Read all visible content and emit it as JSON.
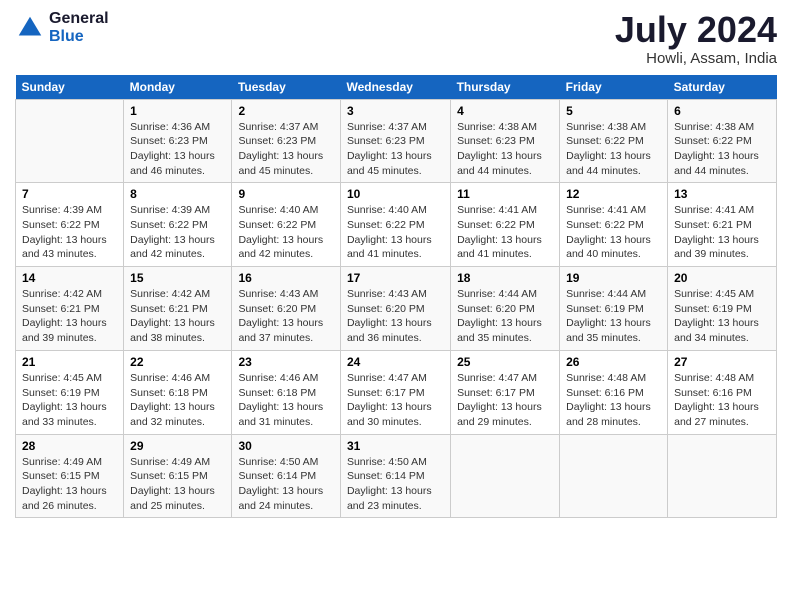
{
  "header": {
    "logo_general": "General",
    "logo_blue": "Blue",
    "month": "July 2024",
    "location": "Howli, Assam, India"
  },
  "days_of_week": [
    "Sunday",
    "Monday",
    "Tuesday",
    "Wednesday",
    "Thursday",
    "Friday",
    "Saturday"
  ],
  "weeks": [
    [
      {
        "day": "",
        "sunrise": "",
        "sunset": "",
        "daylight": ""
      },
      {
        "day": "1",
        "sunrise": "Sunrise: 4:36 AM",
        "sunset": "Sunset: 6:23 PM",
        "daylight": "Daylight: 13 hours and 46 minutes."
      },
      {
        "day": "2",
        "sunrise": "Sunrise: 4:37 AM",
        "sunset": "Sunset: 6:23 PM",
        "daylight": "Daylight: 13 hours and 45 minutes."
      },
      {
        "day": "3",
        "sunrise": "Sunrise: 4:37 AM",
        "sunset": "Sunset: 6:23 PM",
        "daylight": "Daylight: 13 hours and 45 minutes."
      },
      {
        "day": "4",
        "sunrise": "Sunrise: 4:38 AM",
        "sunset": "Sunset: 6:23 PM",
        "daylight": "Daylight: 13 hours and 44 minutes."
      },
      {
        "day": "5",
        "sunrise": "Sunrise: 4:38 AM",
        "sunset": "Sunset: 6:22 PM",
        "daylight": "Daylight: 13 hours and 44 minutes."
      },
      {
        "day": "6",
        "sunrise": "Sunrise: 4:38 AM",
        "sunset": "Sunset: 6:22 PM",
        "daylight": "Daylight: 13 hours and 44 minutes."
      }
    ],
    [
      {
        "day": "7",
        "sunrise": "Sunrise: 4:39 AM",
        "sunset": "Sunset: 6:22 PM",
        "daylight": "Daylight: 13 hours and 43 minutes."
      },
      {
        "day": "8",
        "sunrise": "Sunrise: 4:39 AM",
        "sunset": "Sunset: 6:22 PM",
        "daylight": "Daylight: 13 hours and 42 minutes."
      },
      {
        "day": "9",
        "sunrise": "Sunrise: 4:40 AM",
        "sunset": "Sunset: 6:22 PM",
        "daylight": "Daylight: 13 hours and 42 minutes."
      },
      {
        "day": "10",
        "sunrise": "Sunrise: 4:40 AM",
        "sunset": "Sunset: 6:22 PM",
        "daylight": "Daylight: 13 hours and 41 minutes."
      },
      {
        "day": "11",
        "sunrise": "Sunrise: 4:41 AM",
        "sunset": "Sunset: 6:22 PM",
        "daylight": "Daylight: 13 hours and 41 minutes."
      },
      {
        "day": "12",
        "sunrise": "Sunrise: 4:41 AM",
        "sunset": "Sunset: 6:22 PM",
        "daylight": "Daylight: 13 hours and 40 minutes."
      },
      {
        "day": "13",
        "sunrise": "Sunrise: 4:41 AM",
        "sunset": "Sunset: 6:21 PM",
        "daylight": "Daylight: 13 hours and 39 minutes."
      }
    ],
    [
      {
        "day": "14",
        "sunrise": "Sunrise: 4:42 AM",
        "sunset": "Sunset: 6:21 PM",
        "daylight": "Daylight: 13 hours and 39 minutes."
      },
      {
        "day": "15",
        "sunrise": "Sunrise: 4:42 AM",
        "sunset": "Sunset: 6:21 PM",
        "daylight": "Daylight: 13 hours and 38 minutes."
      },
      {
        "day": "16",
        "sunrise": "Sunrise: 4:43 AM",
        "sunset": "Sunset: 6:20 PM",
        "daylight": "Daylight: 13 hours and 37 minutes."
      },
      {
        "day": "17",
        "sunrise": "Sunrise: 4:43 AM",
        "sunset": "Sunset: 6:20 PM",
        "daylight": "Daylight: 13 hours and 36 minutes."
      },
      {
        "day": "18",
        "sunrise": "Sunrise: 4:44 AM",
        "sunset": "Sunset: 6:20 PM",
        "daylight": "Daylight: 13 hours and 35 minutes."
      },
      {
        "day": "19",
        "sunrise": "Sunrise: 4:44 AM",
        "sunset": "Sunset: 6:19 PM",
        "daylight": "Daylight: 13 hours and 35 minutes."
      },
      {
        "day": "20",
        "sunrise": "Sunrise: 4:45 AM",
        "sunset": "Sunset: 6:19 PM",
        "daylight": "Daylight: 13 hours and 34 minutes."
      }
    ],
    [
      {
        "day": "21",
        "sunrise": "Sunrise: 4:45 AM",
        "sunset": "Sunset: 6:19 PM",
        "daylight": "Daylight: 13 hours and 33 minutes."
      },
      {
        "day": "22",
        "sunrise": "Sunrise: 4:46 AM",
        "sunset": "Sunset: 6:18 PM",
        "daylight": "Daylight: 13 hours and 32 minutes."
      },
      {
        "day": "23",
        "sunrise": "Sunrise: 4:46 AM",
        "sunset": "Sunset: 6:18 PM",
        "daylight": "Daylight: 13 hours and 31 minutes."
      },
      {
        "day": "24",
        "sunrise": "Sunrise: 4:47 AM",
        "sunset": "Sunset: 6:17 PM",
        "daylight": "Daylight: 13 hours and 30 minutes."
      },
      {
        "day": "25",
        "sunrise": "Sunrise: 4:47 AM",
        "sunset": "Sunset: 6:17 PM",
        "daylight": "Daylight: 13 hours and 29 minutes."
      },
      {
        "day": "26",
        "sunrise": "Sunrise: 4:48 AM",
        "sunset": "Sunset: 6:16 PM",
        "daylight": "Daylight: 13 hours and 28 minutes."
      },
      {
        "day": "27",
        "sunrise": "Sunrise: 4:48 AM",
        "sunset": "Sunset: 6:16 PM",
        "daylight": "Daylight: 13 hours and 27 minutes."
      }
    ],
    [
      {
        "day": "28",
        "sunrise": "Sunrise: 4:49 AM",
        "sunset": "Sunset: 6:15 PM",
        "daylight": "Daylight: 13 hours and 26 minutes."
      },
      {
        "day": "29",
        "sunrise": "Sunrise: 4:49 AM",
        "sunset": "Sunset: 6:15 PM",
        "daylight": "Daylight: 13 hours and 25 minutes."
      },
      {
        "day": "30",
        "sunrise": "Sunrise: 4:50 AM",
        "sunset": "Sunset: 6:14 PM",
        "daylight": "Daylight: 13 hours and 24 minutes."
      },
      {
        "day": "31",
        "sunrise": "Sunrise: 4:50 AM",
        "sunset": "Sunset: 6:14 PM",
        "daylight": "Daylight: 13 hours and 23 minutes."
      },
      {
        "day": "",
        "sunrise": "",
        "sunset": "",
        "daylight": ""
      },
      {
        "day": "",
        "sunrise": "",
        "sunset": "",
        "daylight": ""
      },
      {
        "day": "",
        "sunrise": "",
        "sunset": "",
        "daylight": ""
      }
    ]
  ]
}
